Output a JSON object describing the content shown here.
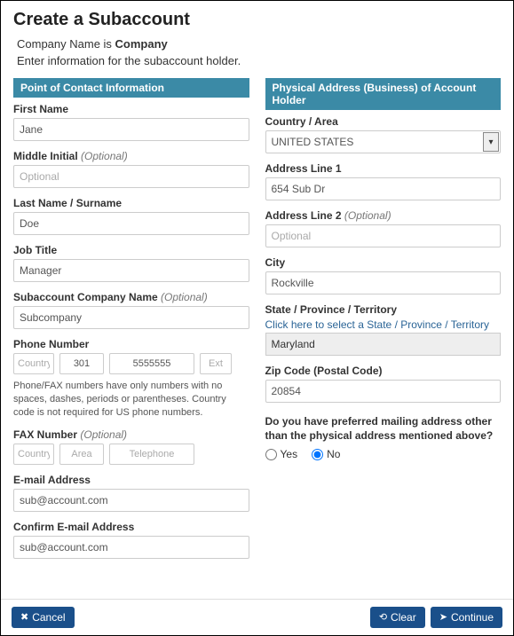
{
  "page": {
    "title": "Create a Subaccount",
    "intro_prefix": "Company Name is ",
    "company_name": "Company",
    "subintro": "Enter information for the subaccount holder."
  },
  "left": {
    "section_title": "Point of Contact Information",
    "first_name": {
      "label": "First Name",
      "value": "Jane"
    },
    "middle_initial": {
      "label": "Middle Initial ",
      "optional": "(Optional)",
      "placeholder": "Optional",
      "value": ""
    },
    "last_name": {
      "label": "Last Name / Surname",
      "value": "Doe"
    },
    "job_title": {
      "label": "Job Title",
      "value": "Manager"
    },
    "sub_company": {
      "label": "Subaccount Company Name ",
      "optional": "(Optional)",
      "value": "Subcompany"
    },
    "phone": {
      "label": "Phone Number",
      "country_ph": "Country",
      "area": "301",
      "tel": "5555555",
      "ext_ph": "Ext",
      "help": "Phone/FAX numbers have only numbers with no spaces, dashes, periods or parentheses. Country code is not required for US phone numbers."
    },
    "fax": {
      "label": "FAX Number ",
      "optional": "(Optional)",
      "country_ph": "Country",
      "area_ph": "Area",
      "tel_ph": "Telephone"
    },
    "email": {
      "label": "E-mail Address",
      "value": "sub@account.com"
    },
    "confirm_email": {
      "label": "Confirm E-mail Address",
      "value": "sub@account.com"
    }
  },
  "right": {
    "section_title": "Physical Address (Business) of Account Holder",
    "country": {
      "label": "Country / Area",
      "value": "UNITED STATES"
    },
    "addr1": {
      "label": "Address Line 1",
      "value": "654 Sub Dr"
    },
    "addr2": {
      "label": "Address Line 2 ",
      "optional": "(Optional)",
      "placeholder": "Optional",
      "value": ""
    },
    "city": {
      "label": "City",
      "value": "Rockville"
    },
    "state": {
      "label": "State / Province / Territory",
      "link": "Click here to select a State / Province / Territory",
      "value": "Maryland"
    },
    "zip": {
      "label": "Zip Code (Postal Code)",
      "value": "20854"
    },
    "mailing_q": "Do you have preferred mailing address other than the physical address mentioned above?",
    "yes": "Yes",
    "no": "No",
    "selected": "no"
  },
  "footer": {
    "cancel": "Cancel",
    "clear": "Clear",
    "continue": "Continue"
  }
}
